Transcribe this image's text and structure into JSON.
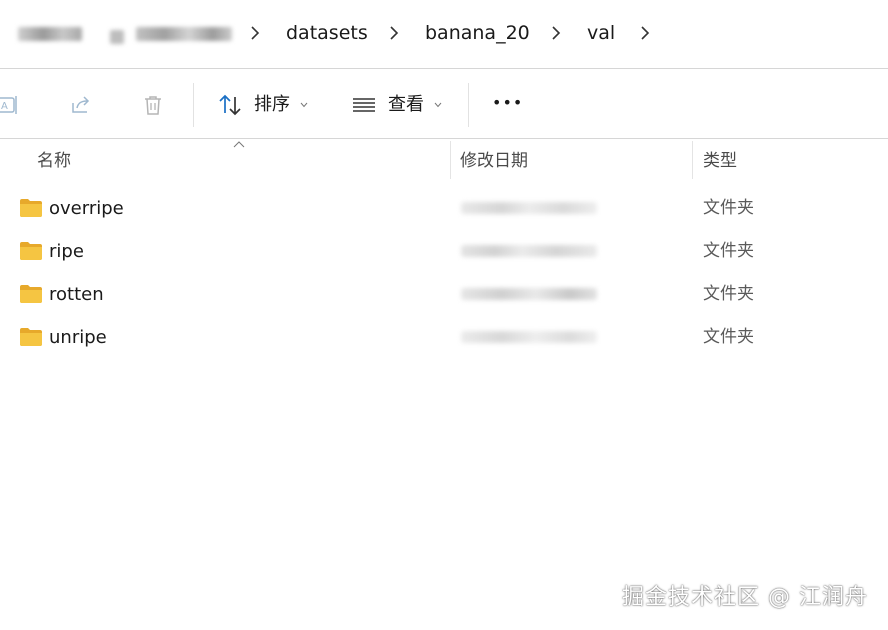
{
  "breadcrumb": {
    "items": [
      {
        "label": "datasets"
      },
      {
        "label": "banana_20"
      },
      {
        "label": "val"
      }
    ]
  },
  "toolbar": {
    "rename_icon": "rename-icon",
    "share_icon": "share-icon",
    "delete_icon": "trash-icon",
    "sort_label": "排序",
    "view_label": "查看",
    "more_label": "•••"
  },
  "columns": {
    "name": "名称",
    "modified": "修改日期",
    "type": "类型"
  },
  "files": [
    {
      "name": "overripe",
      "type": "文件夹"
    },
    {
      "name": "ripe",
      "type": "文件夹"
    },
    {
      "name": "rotten",
      "type": "文件夹"
    },
    {
      "name": "unripe",
      "type": "文件夹"
    }
  ],
  "watermark": "掘金技术社区 @ 江润舟",
  "colors": {
    "accent": "#1a6fc4",
    "folder": "#f5c542",
    "folder_dark": "#e7a92b",
    "icon_disabled": "#9fb8cf"
  }
}
